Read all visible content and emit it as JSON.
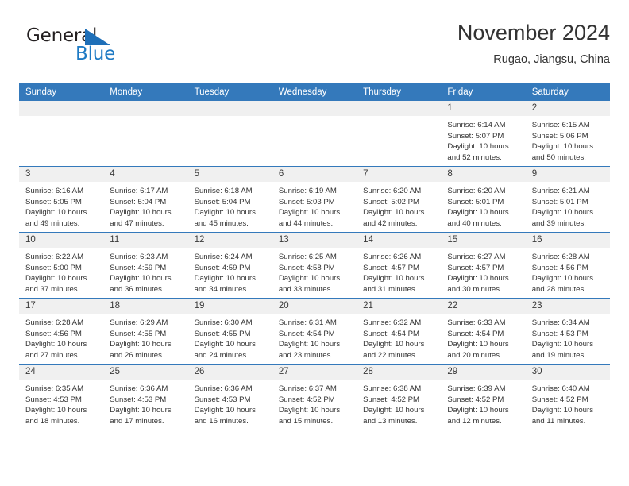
{
  "brand": {
    "name_part1": "General",
    "name_part2": "Blue",
    "accent_color": "#1e7ac4",
    "header_color": "#3479bb"
  },
  "header": {
    "title": "November 2024",
    "subtitle": "Rugao, Jiangsu, China"
  },
  "calendar": {
    "weekday_headers": [
      "Sunday",
      "Monday",
      "Tuesday",
      "Wednesday",
      "Thursday",
      "Friday",
      "Saturday"
    ],
    "weeks": [
      [
        {
          "day": "",
          "sunrise": "",
          "sunset": "",
          "daylight1": "",
          "daylight2": ""
        },
        {
          "day": "",
          "sunrise": "",
          "sunset": "",
          "daylight1": "",
          "daylight2": ""
        },
        {
          "day": "",
          "sunrise": "",
          "sunset": "",
          "daylight1": "",
          "daylight2": ""
        },
        {
          "day": "",
          "sunrise": "",
          "sunset": "",
          "daylight1": "",
          "daylight2": ""
        },
        {
          "day": "",
          "sunrise": "",
          "sunset": "",
          "daylight1": "",
          "daylight2": ""
        },
        {
          "day": "1",
          "sunrise": "Sunrise: 6:14 AM",
          "sunset": "Sunset: 5:07 PM",
          "daylight1": "Daylight: 10 hours",
          "daylight2": "and 52 minutes."
        },
        {
          "day": "2",
          "sunrise": "Sunrise: 6:15 AM",
          "sunset": "Sunset: 5:06 PM",
          "daylight1": "Daylight: 10 hours",
          "daylight2": "and 50 minutes."
        }
      ],
      [
        {
          "day": "3",
          "sunrise": "Sunrise: 6:16 AM",
          "sunset": "Sunset: 5:05 PM",
          "daylight1": "Daylight: 10 hours",
          "daylight2": "and 49 minutes."
        },
        {
          "day": "4",
          "sunrise": "Sunrise: 6:17 AM",
          "sunset": "Sunset: 5:04 PM",
          "daylight1": "Daylight: 10 hours",
          "daylight2": "and 47 minutes."
        },
        {
          "day": "5",
          "sunrise": "Sunrise: 6:18 AM",
          "sunset": "Sunset: 5:04 PM",
          "daylight1": "Daylight: 10 hours",
          "daylight2": "and 45 minutes."
        },
        {
          "day": "6",
          "sunrise": "Sunrise: 6:19 AM",
          "sunset": "Sunset: 5:03 PM",
          "daylight1": "Daylight: 10 hours",
          "daylight2": "and 44 minutes."
        },
        {
          "day": "7",
          "sunrise": "Sunrise: 6:20 AM",
          "sunset": "Sunset: 5:02 PM",
          "daylight1": "Daylight: 10 hours",
          "daylight2": "and 42 minutes."
        },
        {
          "day": "8",
          "sunrise": "Sunrise: 6:20 AM",
          "sunset": "Sunset: 5:01 PM",
          "daylight1": "Daylight: 10 hours",
          "daylight2": "and 40 minutes."
        },
        {
          "day": "9",
          "sunrise": "Sunrise: 6:21 AM",
          "sunset": "Sunset: 5:01 PM",
          "daylight1": "Daylight: 10 hours",
          "daylight2": "and 39 minutes."
        }
      ],
      [
        {
          "day": "10",
          "sunrise": "Sunrise: 6:22 AM",
          "sunset": "Sunset: 5:00 PM",
          "daylight1": "Daylight: 10 hours",
          "daylight2": "and 37 minutes."
        },
        {
          "day": "11",
          "sunrise": "Sunrise: 6:23 AM",
          "sunset": "Sunset: 4:59 PM",
          "daylight1": "Daylight: 10 hours",
          "daylight2": "and 36 minutes."
        },
        {
          "day": "12",
          "sunrise": "Sunrise: 6:24 AM",
          "sunset": "Sunset: 4:59 PM",
          "daylight1": "Daylight: 10 hours",
          "daylight2": "and 34 minutes."
        },
        {
          "day": "13",
          "sunrise": "Sunrise: 6:25 AM",
          "sunset": "Sunset: 4:58 PM",
          "daylight1": "Daylight: 10 hours",
          "daylight2": "and 33 minutes."
        },
        {
          "day": "14",
          "sunrise": "Sunrise: 6:26 AM",
          "sunset": "Sunset: 4:57 PM",
          "daylight1": "Daylight: 10 hours",
          "daylight2": "and 31 minutes."
        },
        {
          "day": "15",
          "sunrise": "Sunrise: 6:27 AM",
          "sunset": "Sunset: 4:57 PM",
          "daylight1": "Daylight: 10 hours",
          "daylight2": "and 30 minutes."
        },
        {
          "day": "16",
          "sunrise": "Sunrise: 6:28 AM",
          "sunset": "Sunset: 4:56 PM",
          "daylight1": "Daylight: 10 hours",
          "daylight2": "and 28 minutes."
        }
      ],
      [
        {
          "day": "17",
          "sunrise": "Sunrise: 6:28 AM",
          "sunset": "Sunset: 4:56 PM",
          "daylight1": "Daylight: 10 hours",
          "daylight2": "and 27 minutes."
        },
        {
          "day": "18",
          "sunrise": "Sunrise: 6:29 AM",
          "sunset": "Sunset: 4:55 PM",
          "daylight1": "Daylight: 10 hours",
          "daylight2": "and 26 minutes."
        },
        {
          "day": "19",
          "sunrise": "Sunrise: 6:30 AM",
          "sunset": "Sunset: 4:55 PM",
          "daylight1": "Daylight: 10 hours",
          "daylight2": "and 24 minutes."
        },
        {
          "day": "20",
          "sunrise": "Sunrise: 6:31 AM",
          "sunset": "Sunset: 4:54 PM",
          "daylight1": "Daylight: 10 hours",
          "daylight2": "and 23 minutes."
        },
        {
          "day": "21",
          "sunrise": "Sunrise: 6:32 AM",
          "sunset": "Sunset: 4:54 PM",
          "daylight1": "Daylight: 10 hours",
          "daylight2": "and 22 minutes."
        },
        {
          "day": "22",
          "sunrise": "Sunrise: 6:33 AM",
          "sunset": "Sunset: 4:54 PM",
          "daylight1": "Daylight: 10 hours",
          "daylight2": "and 20 minutes."
        },
        {
          "day": "23",
          "sunrise": "Sunrise: 6:34 AM",
          "sunset": "Sunset: 4:53 PM",
          "daylight1": "Daylight: 10 hours",
          "daylight2": "and 19 minutes."
        }
      ],
      [
        {
          "day": "24",
          "sunrise": "Sunrise: 6:35 AM",
          "sunset": "Sunset: 4:53 PM",
          "daylight1": "Daylight: 10 hours",
          "daylight2": "and 18 minutes."
        },
        {
          "day": "25",
          "sunrise": "Sunrise: 6:36 AM",
          "sunset": "Sunset: 4:53 PM",
          "daylight1": "Daylight: 10 hours",
          "daylight2": "and 17 minutes."
        },
        {
          "day": "26",
          "sunrise": "Sunrise: 6:36 AM",
          "sunset": "Sunset: 4:53 PM",
          "daylight1": "Daylight: 10 hours",
          "daylight2": "and 16 minutes."
        },
        {
          "day": "27",
          "sunrise": "Sunrise: 6:37 AM",
          "sunset": "Sunset: 4:52 PM",
          "daylight1": "Daylight: 10 hours",
          "daylight2": "and 15 minutes."
        },
        {
          "day": "28",
          "sunrise": "Sunrise: 6:38 AM",
          "sunset": "Sunset: 4:52 PM",
          "daylight1": "Daylight: 10 hours",
          "daylight2": "and 13 minutes."
        },
        {
          "day": "29",
          "sunrise": "Sunrise: 6:39 AM",
          "sunset": "Sunset: 4:52 PM",
          "daylight1": "Daylight: 10 hours",
          "daylight2": "and 12 minutes."
        },
        {
          "day": "30",
          "sunrise": "Sunrise: 6:40 AM",
          "sunset": "Sunset: 4:52 PM",
          "daylight1": "Daylight: 10 hours",
          "daylight2": "and 11 minutes."
        }
      ]
    ]
  }
}
